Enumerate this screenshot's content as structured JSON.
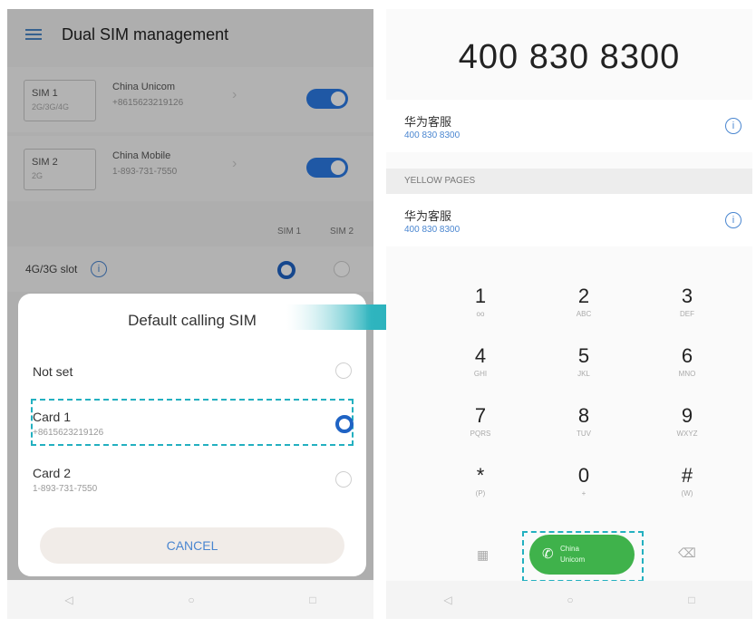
{
  "left": {
    "title": "Dual SIM management",
    "sims": [
      {
        "slot": "SIM 1",
        "type": "2G/3G/4G",
        "carrier": "China Unicom",
        "number": "+8615623219126",
        "enabled": true
      },
      {
        "slot": "SIM 2",
        "type": "2G",
        "carrier": "China Mobile",
        "number": "1-893-731-7550",
        "enabled": true
      }
    ],
    "slot_headers": [
      "SIM 1",
      "SIM 2"
    ],
    "slot_label": "4G/3G slot",
    "dialog": {
      "title": "Default calling SIM",
      "options": [
        {
          "label": "Not set",
          "sub": "",
          "selected": false
        },
        {
          "label": "Card 1",
          "sub": "+8615623219126",
          "selected": true
        },
        {
          "label": "Card 2",
          "sub": "1-893-731-7550",
          "selected": false
        }
      ],
      "cancel": "CANCEL"
    }
  },
  "right": {
    "number": "400 830 8300",
    "contacts": [
      {
        "name": "华为客服",
        "number": "400 830 8300"
      },
      {
        "name": "华为客服",
        "number": "400 830 8300"
      }
    ],
    "section": "YELLOW PAGES",
    "keys": [
      {
        "digit": "1",
        "letters": "oo"
      },
      {
        "digit": "2",
        "letters": "ABC"
      },
      {
        "digit": "3",
        "letters": "DEF"
      },
      {
        "digit": "4",
        "letters": "GHI"
      },
      {
        "digit": "5",
        "letters": "JKL"
      },
      {
        "digit": "6",
        "letters": "MNO"
      },
      {
        "digit": "7",
        "letters": "PQRS"
      },
      {
        "digit": "8",
        "letters": "TUV"
      },
      {
        "digit": "9",
        "letters": "WXYZ"
      },
      {
        "digit": "*",
        "letters": "(P)"
      },
      {
        "digit": "0",
        "letters": "+"
      },
      {
        "digit": "#",
        "letters": "(W)"
      }
    ],
    "call_label_1": "China",
    "call_label_2": "Unicom"
  },
  "colors": {
    "accent": "#2c7be5",
    "highlight": "#23b0c0",
    "call": "#3fb24b"
  }
}
